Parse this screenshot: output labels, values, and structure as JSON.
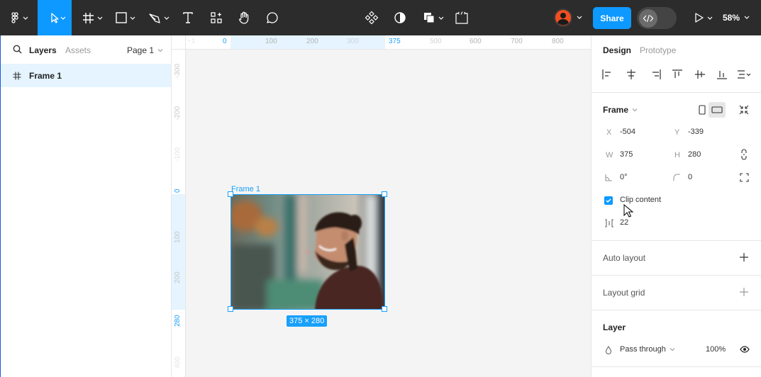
{
  "toolbar": {
    "share_label": "Share",
    "zoom": "58%",
    "accent": "#0d99ff",
    "icons": [
      "figma-menu-icon",
      "move-tool-icon",
      "frame-tool-icon",
      "shape-tool-icon",
      "pen-tool-icon",
      "text-tool-icon",
      "resources-icon",
      "hand-tool-icon",
      "comment-icon",
      "component-icon",
      "contrast-icon",
      "boolean-icon",
      "dev-mode-icon",
      "avatar",
      "code-icon",
      "play-icon"
    ]
  },
  "left_panel": {
    "tabs": [
      "Layers",
      "Assets"
    ],
    "page": "Page 1",
    "layers": [
      {
        "name": "Frame 1"
      }
    ]
  },
  "canvas": {
    "frame_label": "Frame 1",
    "size_badge": "375 × 280",
    "h_ruler": [
      "0",
      "100",
      "200",
      "300",
      "375",
      "500",
      "600",
      "700",
      "800"
    ],
    "v_ruler": [
      "-300",
      "-200",
      "-100",
      "0",
      "100",
      "200",
      "280",
      "400"
    ]
  },
  "right_panel": {
    "tabs": [
      "Design",
      "Prototype"
    ],
    "frame_title": "Frame",
    "props": {
      "x_label": "X",
      "x": "-504",
      "y_label": "Y",
      "y": "-339",
      "w_label": "W",
      "w": "375",
      "h_label": "H",
      "h": "280",
      "rotation": "0°",
      "radius": "0"
    },
    "clip_content": {
      "label": "Clip content",
      "checked": true
    },
    "gap": "22",
    "sections": {
      "auto_layout": "Auto layout",
      "layout_grid": "Layout grid",
      "layer": "Layer"
    },
    "layer": {
      "blend": "Pass through",
      "opacity": "100%"
    }
  }
}
